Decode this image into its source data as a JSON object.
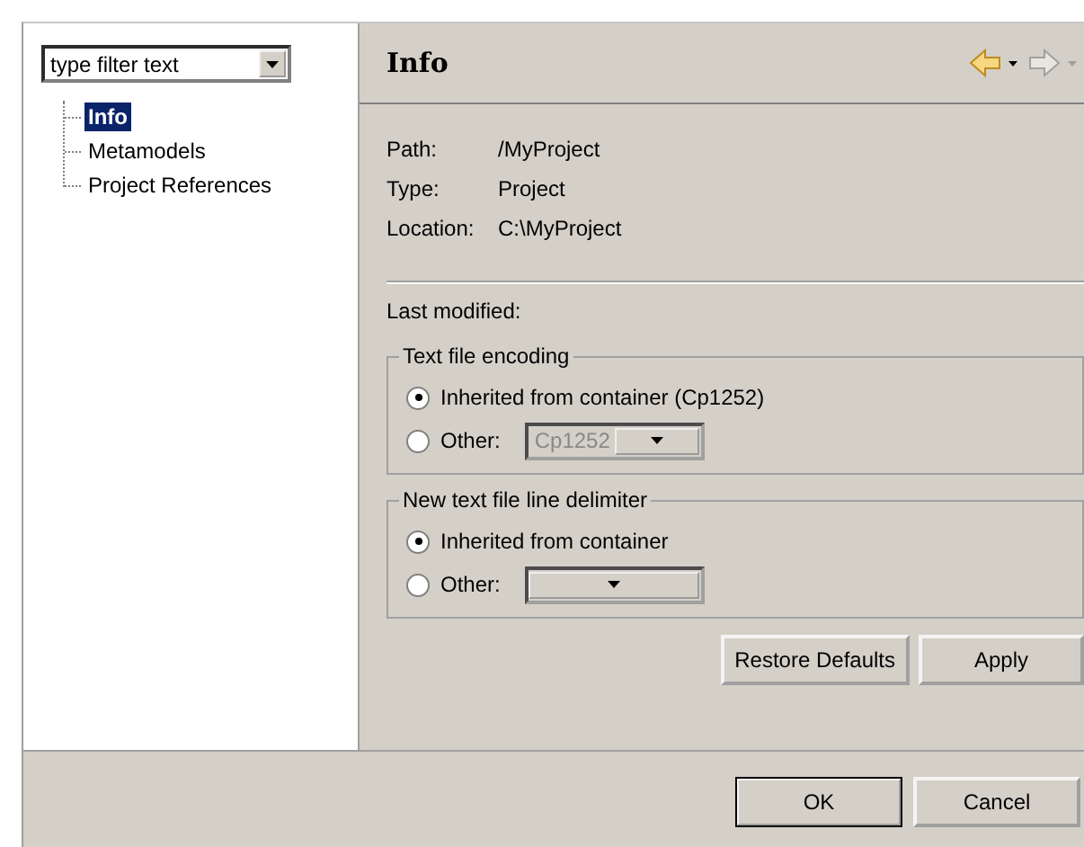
{
  "filter": {
    "placeholder": "type filter text"
  },
  "tree": [
    {
      "label": "Info",
      "selected": true
    },
    {
      "label": "Metamodels",
      "selected": false
    },
    {
      "label": "Project References",
      "selected": false
    }
  ],
  "page": {
    "title": "Info",
    "nav": [
      {
        "kind": "back",
        "disabled": false
      },
      {
        "kind": "forward",
        "disabled": true
      }
    ]
  },
  "properties": [
    {
      "label": "Path:",
      "value": "/MyProject"
    },
    {
      "label": "Type:",
      "value": "Project"
    },
    {
      "label": "Location:",
      "value": "C:\\MyProject"
    }
  ],
  "last_modified": {
    "label": "Last modified:"
  },
  "groups": [
    {
      "title": "Text file encoding",
      "options": [
        {
          "kind": "radio",
          "label": "Inherited from container (Cp1252)",
          "selected": true
        },
        {
          "kind": "radio-combo",
          "label": "Other:",
          "selected": false,
          "combo": {
            "value": "Cp1252",
            "disabled": true
          }
        }
      ]
    },
    {
      "title": "New text file line delimiter",
      "options": [
        {
          "kind": "radio",
          "label": "Inherited from container",
          "selected": true
        },
        {
          "kind": "radio-combo",
          "label": "Other:",
          "selected": false,
          "combo": {
            "disabled": true
          }
        }
      ]
    }
  ],
  "page_buttons": [
    {
      "label": "Restore Defaults",
      "default": false
    },
    {
      "label": "Apply",
      "default": false
    }
  ],
  "dialog_buttons": [
    {
      "label": "OK",
      "default": true
    },
    {
      "label": "Cancel",
      "default": false
    }
  ]
}
